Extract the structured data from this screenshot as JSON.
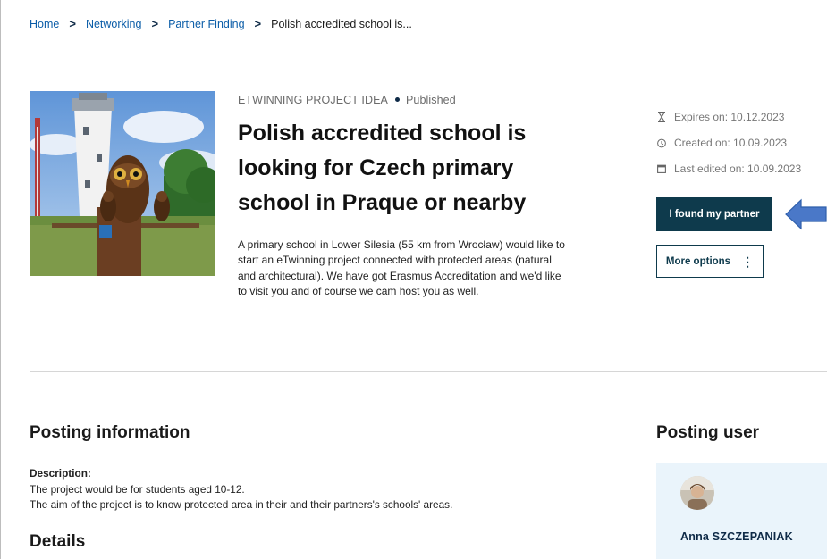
{
  "breadcrumb": {
    "home": "Home",
    "networking": "Networking",
    "partner_finding": "Partner Finding",
    "current": "Polish accredited school is..."
  },
  "posting": {
    "type": "ETWINNING PROJECT IDEA",
    "status": "Published",
    "title": "Polish accredited school is looking for Czech primary school in Praque or nearby",
    "summary": "A primary school in Lower Silesia (55 km from Wrocław) would like to start an eTwinning project connected with protected areas (natural and architectural). We have got Erasmus Accreditation and we'd like to visit you and of course we cam host you as well."
  },
  "meta": {
    "expires": "Expires on: 10.12.2023",
    "created": "Created on: 10.09.2023",
    "edited": "Last edited on: 10.09.2023"
  },
  "actions": {
    "found_partner": "I found my partner",
    "more_options": "More options"
  },
  "info": {
    "heading": "Posting information",
    "description_label": "Description:",
    "line1": "The project would be for students aged 10-12.",
    "line2": "The aim of the project is to know protected area in their and their partners's schools' areas.",
    "details_heading": "Details"
  },
  "posting_user": {
    "heading": "Posting user",
    "name": "Anna SZCZEPANIAK"
  },
  "icons": {
    "expires": "hourglass-icon",
    "created": "clock-icon",
    "edited": "calendar-icon",
    "more": "kebab-icon",
    "annotation": "arrow-left-icon"
  },
  "colors": {
    "primary": "#0e3a4c",
    "link": "#0b5da8",
    "card_bg": "#eaf4fb",
    "annotation_arrow": "#4a78c8"
  }
}
